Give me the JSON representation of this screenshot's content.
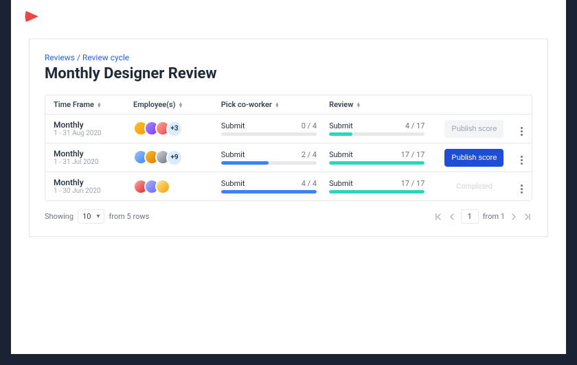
{
  "breadcrumb": {
    "parent": "Reviews",
    "sep": "/",
    "child": "Review cycle"
  },
  "pageTitle": "Monthly Designer Review",
  "columns": {
    "time": "Time Frame",
    "emp": "Employee(s)",
    "pick": "Pick co-worker",
    "review": "Review"
  },
  "rows": [
    {
      "period": "Monthly",
      "range": "1 - 31 Aug 2020",
      "avatarColors": [
        "linear-gradient(135deg,#fbbf24,#f59e0b)",
        "linear-gradient(135deg,#a78bfa,#7c3aed)",
        "linear-gradient(135deg,#fca5a5,#ef4444)"
      ],
      "extra": "+3",
      "pick": {
        "label": "Submit",
        "count": "0 / 4",
        "pct": 0
      },
      "review": {
        "label": "Submit",
        "count": "4 / 17",
        "pct": 24
      },
      "action": {
        "text": "Publish score",
        "style": "disabled"
      }
    },
    {
      "period": "Monthly",
      "range": "1 - 31 Jul 2020",
      "avatarColors": [
        "linear-gradient(135deg,#93c5fd,#3b82f6)",
        "linear-gradient(135deg,#fbbf24,#d97706)",
        "linear-gradient(135deg,#d1d5db,#6b7280)"
      ],
      "extra": "+9",
      "pick": {
        "label": "Submit",
        "count": "2 / 4",
        "pct": 50
      },
      "review": {
        "label": "Submit",
        "count": "17 / 17",
        "pct": 100
      },
      "action": {
        "text": "Publish score",
        "style": "primary"
      }
    },
    {
      "period": "Monthly",
      "range": "1 - 30 Jun 2020",
      "avatarColors": [
        "linear-gradient(135deg,#fca5a5,#dc2626)",
        "linear-gradient(135deg,#a5b4fc,#6366f1)",
        "linear-gradient(135deg,#fde68a,#f59e0b)"
      ],
      "extra": "",
      "pick": {
        "label": "Submit",
        "count": "4 / 4",
        "pct": 100
      },
      "review": {
        "label": "Submit",
        "count": "17 / 17",
        "pct": 100
      },
      "action": {
        "text": "Completed",
        "style": "completed"
      }
    }
  ],
  "pagination": {
    "showing": "Showing",
    "pageSize": "10",
    "fromRows": "from 5 rows",
    "page": "1",
    "fromPages": "from 1"
  },
  "colors": {
    "brand": "#ef4444",
    "link": "#2563eb",
    "primaryBtn": "#1d4ed8",
    "barBlue": "#3b82f6",
    "barTeal": "#2dd4bf"
  }
}
